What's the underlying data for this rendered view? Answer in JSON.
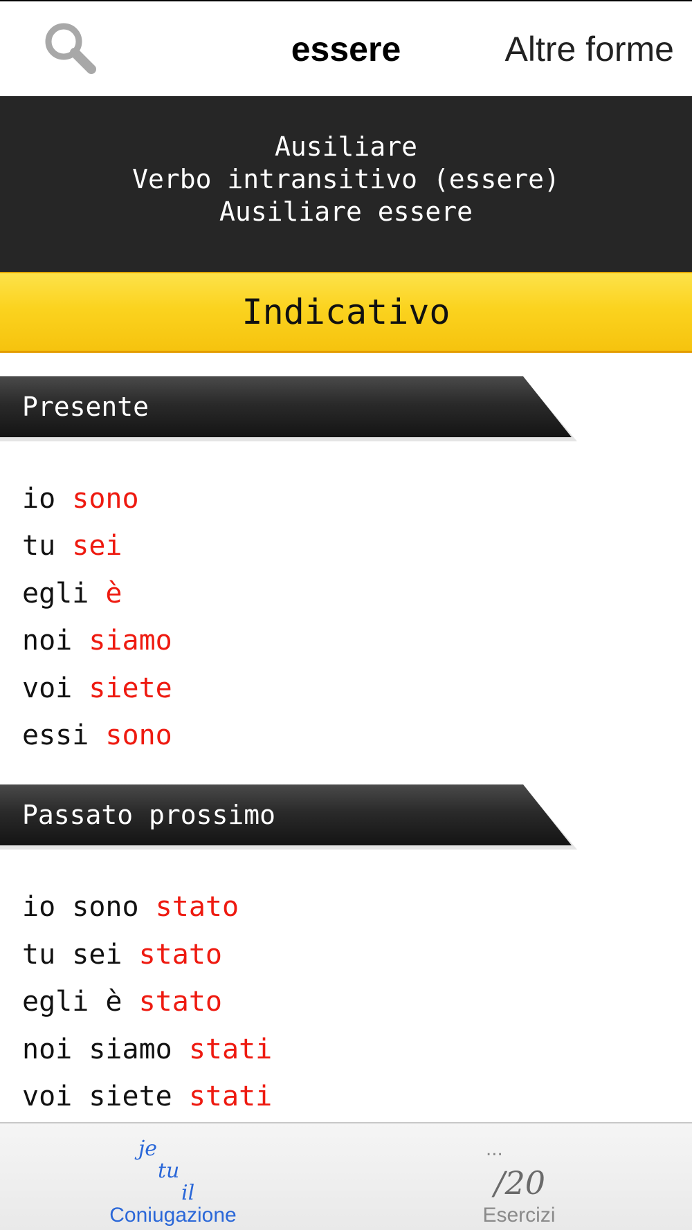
{
  "nav": {
    "search_icon": "search-icon",
    "title": "essere",
    "other_forms": "Altre forme"
  },
  "verb_info": {
    "line1": "Ausiliare",
    "line2": "Verbo intransitivo (essere)",
    "line3": "Ausiliare essere"
  },
  "mode": "Indicativo",
  "tenses": [
    {
      "name": "Presente",
      "rows": [
        {
          "pronoun": "io ",
          "form": "sono"
        },
        {
          "pronoun": "tu ",
          "form": "sei"
        },
        {
          "pronoun": "egli ",
          "form": "è"
        },
        {
          "pronoun": "noi ",
          "form": "siamo"
        },
        {
          "pronoun": "voi ",
          "form": "siete"
        },
        {
          "pronoun": "essi ",
          "form": "sono"
        }
      ]
    },
    {
      "name": "Passato prossimo",
      "rows": [
        {
          "pronoun": "io sono ",
          "form": "stato"
        },
        {
          "pronoun": "tu sei ",
          "form": "stato"
        },
        {
          "pronoun": "egli è ",
          "form": "stato"
        },
        {
          "pronoun": "noi siamo ",
          "form": "stati"
        },
        {
          "pronoun": "voi siete ",
          "form": "stati"
        }
      ]
    }
  ],
  "tabbar": {
    "tabs": [
      {
        "label": "Coniugazione",
        "icon": "conjugation-icon",
        "active": true,
        "icon_text_1": "je",
        "icon_text_2": "tu",
        "icon_text_3": "il"
      },
      {
        "label": "Esercizi",
        "icon": "exercises-icon",
        "active": false,
        "icon_text_1": "...",
        "icon_text_2": "/20"
      }
    ]
  },
  "colors": {
    "header_bg": "#262626",
    "mode_bar": "#fbd31f",
    "verb_form": "#ee1a10",
    "tab_active": "#2a67d8",
    "tab_inactive": "#8a8a8a"
  }
}
